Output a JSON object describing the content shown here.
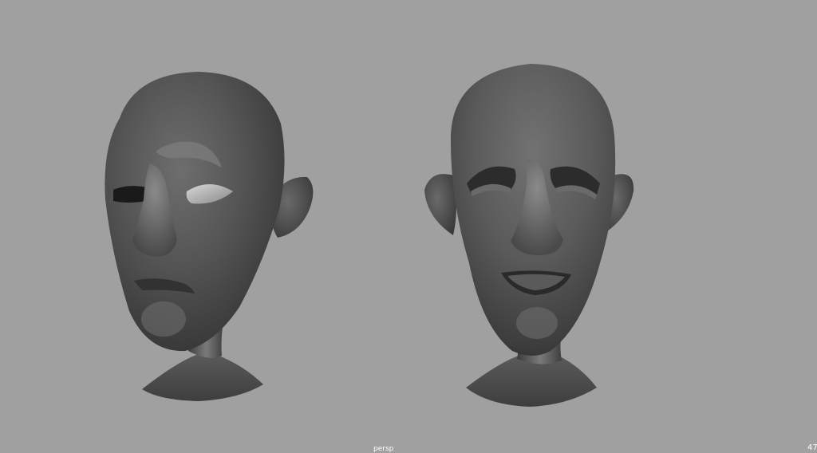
{
  "viewport": {
    "camera_label": "persp",
    "corner_label": "47",
    "background_color": "#a0a0a0"
  },
  "scene": {
    "objects": [
      {
        "name": "head-model-left",
        "shading": "smooth-gray"
      },
      {
        "name": "head-model-right",
        "shading": "smooth-gray"
      }
    ]
  }
}
